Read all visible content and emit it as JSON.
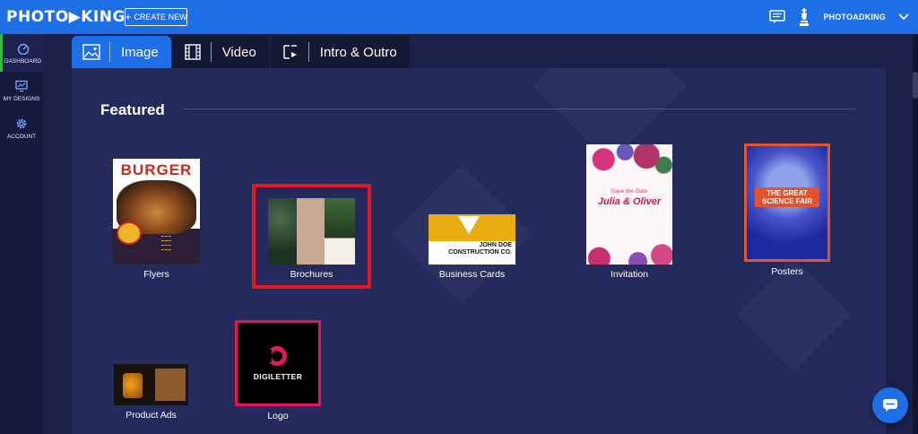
{
  "header": {
    "logo_text": "PHOTO▶KING",
    "create_button": "CREATE NEW",
    "username": "PHOTOADKING"
  },
  "sidebar": {
    "items": [
      {
        "label": "DASHBOARD",
        "icon": "dashboard-icon",
        "active": true
      },
      {
        "label": "MY DESIGNS",
        "icon": "monitor-icon",
        "active": false
      },
      {
        "label": "ACCOUNT",
        "icon": "gear-icon",
        "active": false
      }
    ]
  },
  "tabs": [
    {
      "label": "Image",
      "icon": "image-icon",
      "active": true
    },
    {
      "label": "Video",
      "icon": "film-icon",
      "active": false
    },
    {
      "label": "Intro & Outro",
      "icon": "intro-outro-icon",
      "active": false
    }
  ],
  "section": {
    "title": "Featured"
  },
  "categories": [
    {
      "label": "Flyers",
      "thumb_text": "BURGER"
    },
    {
      "label": "Brochures",
      "highlight_color": "#e3171d"
    },
    {
      "label": "Business Cards",
      "thumb_text_1": "JOHN DOE",
      "thumb_text_2": "CONSTRUCTION CO."
    },
    {
      "label": "Invitation",
      "thumb_text_1": "Save the Date",
      "thumb_text_2": "Julia & Oliver"
    },
    {
      "label": "Posters",
      "thumb_text": "THE GREAT SCIENCE FAIR",
      "highlight_color": "#e3532f"
    },
    {
      "label": "Product Ads"
    },
    {
      "label": "Logo",
      "thumb_text": "DIGILETTER",
      "highlight_color": "#e1145e"
    }
  ],
  "colors": {
    "topbar": "#1e6fe6",
    "background": "#1b2048",
    "panel": "#242a5c",
    "sidebar_active_accent": "#39b54a"
  }
}
